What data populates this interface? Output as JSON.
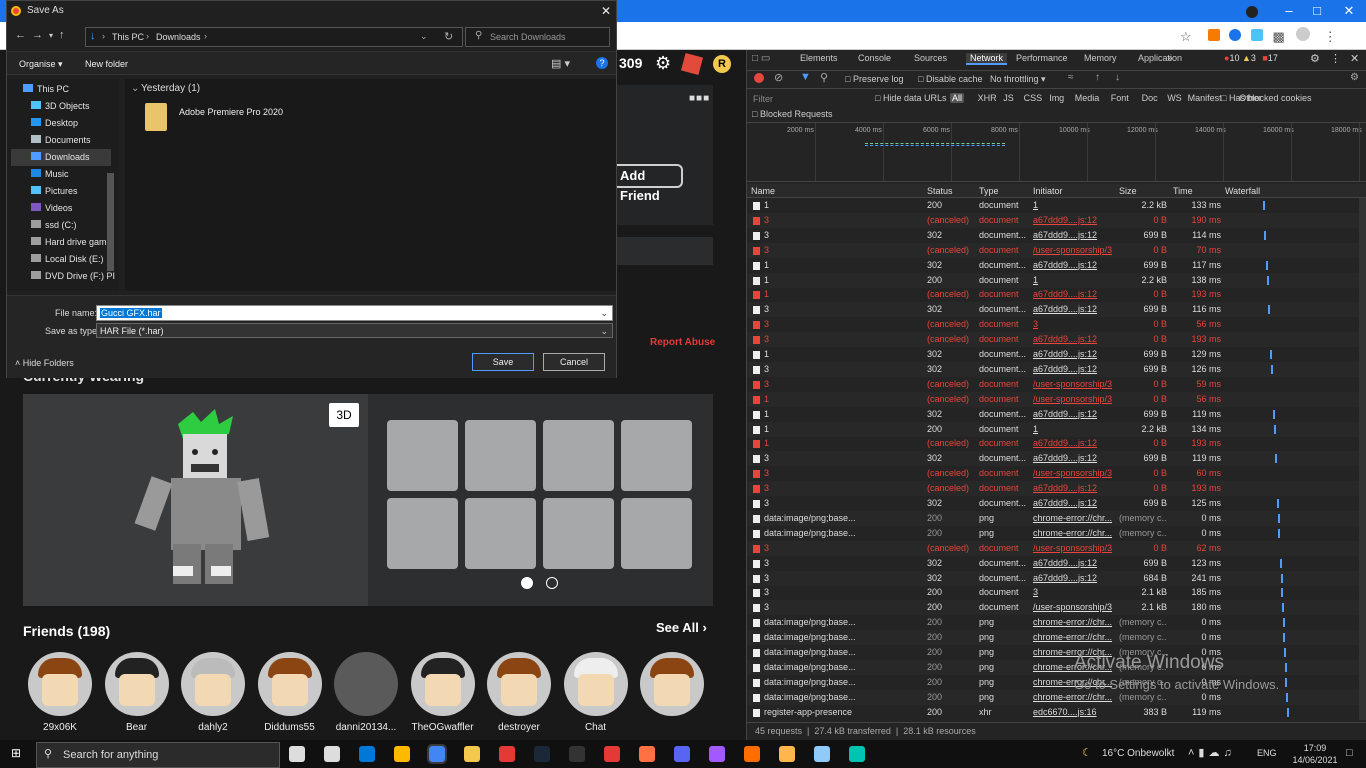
{
  "dialog": {
    "title": "Save As",
    "breadcrumb": [
      "This PC",
      "Downloads"
    ],
    "search_placeholder": "Search Downloads",
    "toolbar": {
      "organise": "Organise",
      "new_folder": "New folder"
    },
    "nav_items": [
      "This PC",
      "3D Objects",
      "Desktop",
      "Documents",
      "Downloads",
      "Music",
      "Pictures",
      "Videos",
      "ssd (C:)",
      "Hard drive game",
      "Local Disk (E:)",
      "DVD Drive (F:) PI"
    ],
    "group_header": "Yesterday (1)",
    "files": [
      {
        "name": "Adobe Premiere Pro 2020"
      }
    ],
    "file_name_label": "File name:",
    "file_name_value": "Gucci GFX.har",
    "save_as_type_label": "Save as type:",
    "save_as_type_value": "HAR File (*.har)",
    "hide_folders": "Hide Folders",
    "save": "Save",
    "cancel": "Cancel"
  },
  "roblox": {
    "robux": "309",
    "add_friend": "Add Friend",
    "report_abuse": "Report Abuse",
    "currently_wearing": "Currently Wearing",
    "btn_3d": "3D",
    "friends_title": "Friends (198)",
    "see_all": "See All",
    "friends": [
      "29x06K",
      "Bear",
      "dahly2",
      "Diddums55",
      "danni20134...",
      "TheOGwaffler",
      "destroyer",
      "Chat",
      ""
    ]
  },
  "devtools": {
    "tabs": [
      "Elements",
      "Console",
      "Sources",
      "Network",
      "Performance",
      "Memory",
      "Application"
    ],
    "active_tab": "Network",
    "errors": "10",
    "warnings": "3",
    "issues": "17",
    "preserve_log": "Preserve log",
    "disable_cache": "Disable cache",
    "throttling": "No throttling",
    "filter_placeholder": "Filter",
    "hide_data_urls": "Hide data URLs",
    "types": [
      "All",
      "XHR",
      "JS",
      "CSS",
      "Img",
      "Media",
      "Font",
      "Doc",
      "WS",
      "Manifest",
      "Other"
    ],
    "has_blocked_cookies": "Has blocked cookies",
    "blocked_requests": "Blocked Requests",
    "timeline_ticks": [
      "2000 ms",
      "4000 ms",
      "6000 ms",
      "8000 ms",
      "10000 ms",
      "12000 ms",
      "14000 ms",
      "16000 ms",
      "18000 ms"
    ],
    "columns": [
      "Name",
      "Status",
      "Type",
      "Initiator",
      "Size",
      "Time",
      "Waterfall"
    ],
    "rows": [
      [
        "1",
        "200",
        "document",
        "1",
        "2.2 kB",
        "133 ms",
        0
      ],
      [
        "3",
        "(canceled)",
        "document",
        "a67ddd9....js:12",
        "0 B",
        "190 ms",
        1
      ],
      [
        "3",
        "302",
        "document...",
        "a67ddd9....js:12",
        "699 B",
        "114 ms",
        0
      ],
      [
        "3",
        "(canceled)",
        "document",
        "/user-sponsorship/3",
        "0 B",
        "70 ms",
        1
      ],
      [
        "1",
        "302",
        "document...",
        "a67ddd9....js:12",
        "699 B",
        "117 ms",
        0
      ],
      [
        "1",
        "200",
        "document",
        "1",
        "2.2 kB",
        "138 ms",
        0
      ],
      [
        "1",
        "(canceled)",
        "document",
        "a67ddd9....js:12",
        "0 B",
        "193 ms",
        1
      ],
      [
        "3",
        "302",
        "document...",
        "a67ddd9....js:12",
        "699 B",
        "116 ms",
        0
      ],
      [
        "3",
        "(canceled)",
        "document",
        "3",
        "0 B",
        "56 ms",
        1
      ],
      [
        "3",
        "(canceled)",
        "document",
        "a67ddd9....js:12",
        "0 B",
        "193 ms",
        1
      ],
      [
        "1",
        "302",
        "document...",
        "a67ddd9....js:12",
        "699 B",
        "129 ms",
        0
      ],
      [
        "3",
        "302",
        "document...",
        "a67ddd9....js:12",
        "699 B",
        "126 ms",
        0
      ],
      [
        "3",
        "(canceled)",
        "document",
        "/user-sponsorship/3",
        "0 B",
        "59 ms",
        1
      ],
      [
        "1",
        "(canceled)",
        "document",
        "/user-sponsorship/3",
        "0 B",
        "56 ms",
        1
      ],
      [
        "1",
        "302",
        "document...",
        "a67ddd9....js:12",
        "699 B",
        "119 ms",
        0
      ],
      [
        "1",
        "200",
        "document",
        "1",
        "2.2 kB",
        "134 ms",
        0
      ],
      [
        "1",
        "(canceled)",
        "document",
        "a67ddd9....js:12",
        "0 B",
        "193 ms",
        1
      ],
      [
        "3",
        "302",
        "document...",
        "a67ddd9....js:12",
        "699 B",
        "119 ms",
        0
      ],
      [
        "3",
        "(canceled)",
        "document",
        "/user-sponsorship/3",
        "0 B",
        "60 ms",
        1
      ],
      [
        "3",
        "(canceled)",
        "document",
        "a67ddd9....js:12",
        "0 B",
        "193 ms",
        1
      ],
      [
        "3",
        "302",
        "document...",
        "a67ddd9....js:12",
        "699 B",
        "125 ms",
        0
      ],
      [
        "data:image/png;base...",
        "200",
        "png",
        "chrome-error://chr...",
        "(memory c...",
        "0 ms",
        2
      ],
      [
        "data:image/png;base...",
        "200",
        "png",
        "chrome-error://chr...",
        "(memory c...",
        "0 ms",
        2
      ],
      [
        "3",
        "(canceled)",
        "document",
        "/user-sponsorship/3",
        "0 B",
        "62 ms",
        1
      ],
      [
        "3",
        "302",
        "document...",
        "a67ddd9....js:12",
        "699 B",
        "123 ms",
        0
      ],
      [
        "3",
        "302",
        "document...",
        "a67ddd9....js:12",
        "684 B",
        "241 ms",
        0
      ],
      [
        "3",
        "200",
        "document",
        "3",
        "2.1 kB",
        "185 ms",
        0
      ],
      [
        "3",
        "200",
        "document",
        "/user-sponsorship/3",
        "2.1 kB",
        "180 ms",
        0
      ],
      [
        "data:image/png;base...",
        "200",
        "png",
        "chrome-error://chr...",
        "(memory c...",
        "0 ms",
        2
      ],
      [
        "data:image/png;base...",
        "200",
        "png",
        "chrome-error://chr...",
        "(memory c...",
        "0 ms",
        2
      ],
      [
        "data:image/png;base...",
        "200",
        "png",
        "chrome-error://chr...",
        "(memory c...",
        "0 ms",
        2
      ],
      [
        "data:image/png;base...",
        "200",
        "png",
        "chrome-error://chr...",
        "(memory c...",
        "0 ms",
        2
      ],
      [
        "data:image/png;base...",
        "200",
        "png",
        "chrome-error://chr...",
        "(memory c...",
        "0 ms",
        2
      ],
      [
        "data:image/png;base...",
        "200",
        "png",
        "chrome-error://chr...",
        "(memory c...",
        "0 ms",
        2
      ],
      [
        "register-app-presence",
        "200",
        "xhr",
        "edc6670....js:16",
        "383 B",
        "119 ms",
        0
      ]
    ],
    "summary": [
      "45 requests",
      "27.4 kB transferred",
      "28.1 kB resources"
    ]
  },
  "watermark": {
    "line1": "Activate Windows",
    "line2": "Go to Settings to activate Windows."
  },
  "taskbar": {
    "search": "Search for anything",
    "weather": "16°C  Onbewolkt",
    "lang": "ENG",
    "time": "17:09",
    "date": "14/06/2021"
  },
  "colors": {
    "accent": "#1a73e8",
    "canceled": "#e8453c",
    "link": "#8ab4f8",
    "devtools_bg": "#242424"
  }
}
